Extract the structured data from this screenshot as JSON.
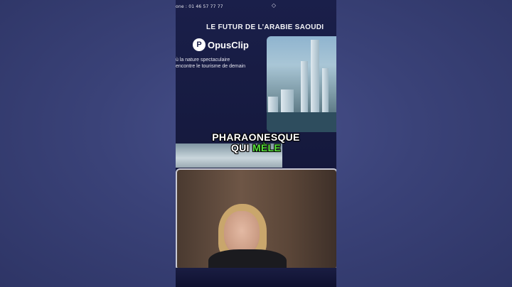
{
  "overlay": {
    "phone_text": "one : 01 46 57 77 77",
    "logo_icon": "diamond-logo-icon",
    "slide_title": "LE FUTUR DE L’ARABIE SAOUDI",
    "watermark_letter": "P",
    "watermark_text": "OpusClip",
    "subtitle": "ù la nature spectaculaire\nencontre le tourisme de demain"
  },
  "captions": {
    "line1": "PHARAONESQUE",
    "line2_white": "QUI",
    "line2_highlight": "MÈLE"
  },
  "colors": {
    "background": "#3a4278",
    "highlight": "#57e03a"
  }
}
